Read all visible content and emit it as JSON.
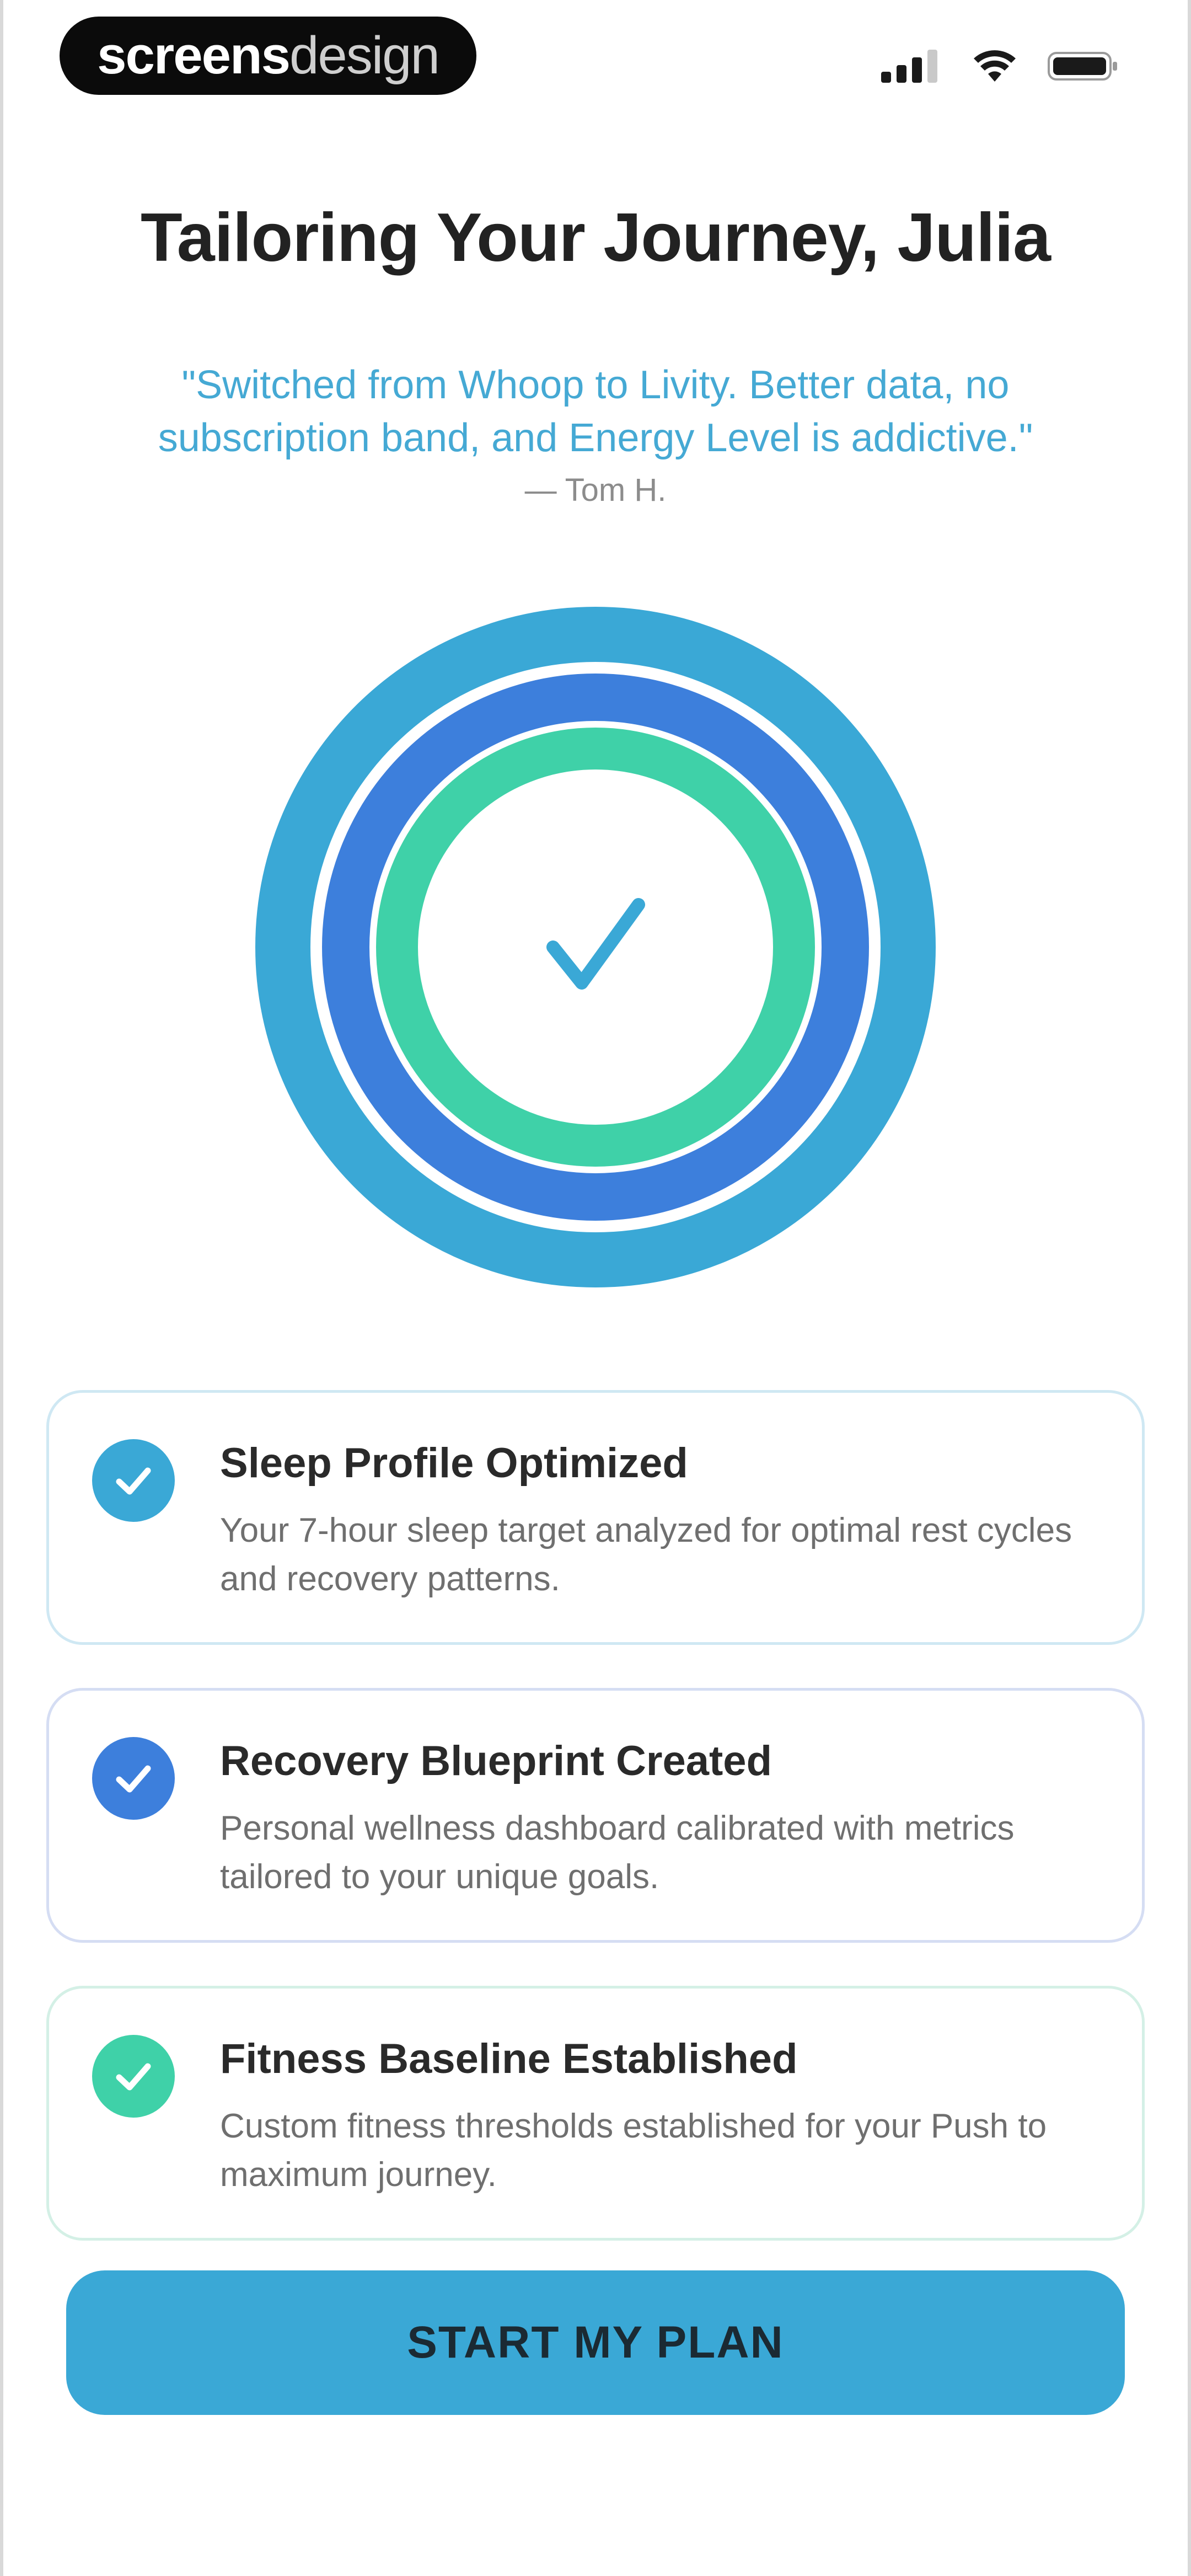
{
  "status_bar": {
    "brand_part1": "screens",
    "brand_part2": "design"
  },
  "header": {
    "title": "Tailoring Your Journey, Julia",
    "quote": "\"Switched from Whoop to Livity. Better data, no subscription band, and Energy Level is addictive.\"",
    "author": "— Tom H."
  },
  "rings": {
    "outer_color": "#3aa8d6",
    "middle_color": "#3d7fdc",
    "inner_color": "#3fd1a8"
  },
  "cards": [
    {
      "title": "Sleep Profile Optimized",
      "description": "Your 7-hour sleep target analyzed for optimal rest cycles and recovery patterns.",
      "badge_color": "#3aa8d6"
    },
    {
      "title": "Recovery Blueprint Created",
      "description": "Personal wellness dashboard calibrated with metrics tailored to your unique goals.",
      "badge_color": "#3d7fdc"
    },
    {
      "title": "Fitness Baseline Established",
      "description": "Custom fitness thresholds established for your Push to maximum journey.",
      "badge_color": "#3fd1a8"
    }
  ],
  "cta": {
    "label": "START MY PLAN",
    "color": "#3aa8d6"
  }
}
